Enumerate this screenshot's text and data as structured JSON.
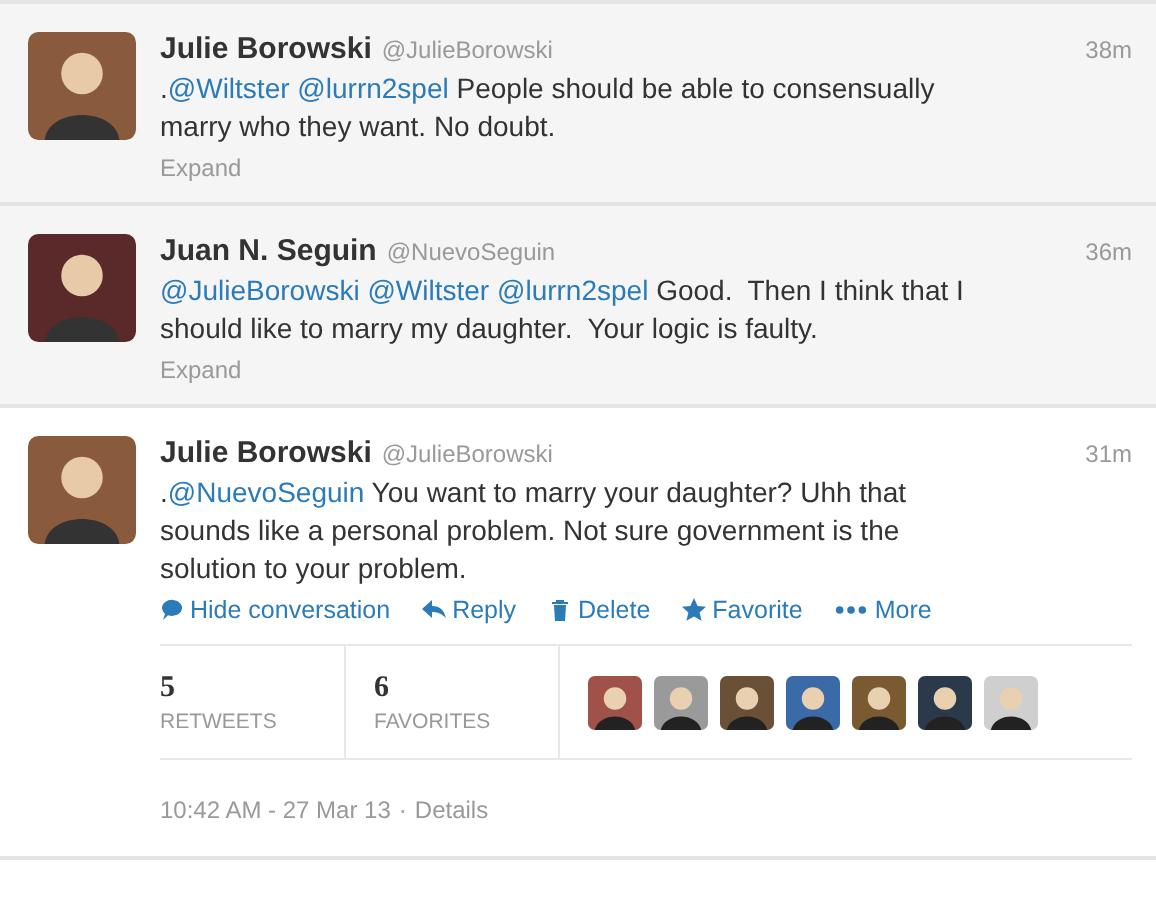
{
  "tweets": [
    {
      "name": "Julie Borowski",
      "handle": "@JulieBorowski",
      "time": "38m",
      "expanded": false,
      "body": [
        {
          "kind": "text",
          "text": "."
        },
        {
          "kind": "mention",
          "text": "@Wiltster"
        },
        {
          "kind": "mention",
          "text": "@lurrn2spel"
        },
        {
          "kind": "text",
          "text": " People should be able to consensually marry who they want. No doubt."
        }
      ],
      "expand": "Expand"
    },
    {
      "name": "Juan N. Seguin",
      "handle": "@NuevoSeguin",
      "time": "36m",
      "expanded": false,
      "body": [
        {
          "kind": "mention",
          "text": "@JulieBorowski"
        },
        {
          "kind": "mention",
          "text": "@Wiltster"
        },
        {
          "kind": "mention",
          "text": "@lurrn2spel"
        },
        {
          "kind": "text",
          "text": " Good.  Then I think that I should like to marry my daughter.  Your logic is faulty."
        }
      ],
      "expand": "Expand"
    },
    {
      "name": "Julie Borowski",
      "handle": "@JulieBorowski",
      "time": "31m",
      "expanded": true,
      "body": [
        {
          "kind": "text",
          "text": "."
        },
        {
          "kind": "mention",
          "text": "@NuevoSeguin"
        },
        {
          "kind": "text",
          "text": " You want to marry your daughter? Uhh that sounds like a personal problem. Not sure government is the solution to your problem."
        }
      ],
      "actions": [
        {
          "kind": "conversation",
          "label": "Hide conversation"
        },
        {
          "kind": "reply",
          "label": "Reply"
        },
        {
          "kind": "delete",
          "label": "Delete"
        },
        {
          "kind": "favorite",
          "label": "Favorite"
        },
        {
          "kind": "more",
          "label": "More"
        }
      ],
      "stats": [
        {
          "count": "5",
          "label": "RETWEETS"
        },
        {
          "count": "6",
          "label": "FAVORITES"
        }
      ],
      "favoriters": [
        {
          "kind": "avatar"
        },
        {
          "kind": "avatar"
        },
        {
          "kind": "avatar"
        },
        {
          "kind": "avatar"
        },
        {
          "kind": "avatar"
        },
        {
          "kind": "avatar"
        },
        {
          "kind": "avatar"
        }
      ],
      "timestamp": "10:42 AM - 27 Mar 13",
      "separator": "·",
      "details": "Details"
    }
  ]
}
